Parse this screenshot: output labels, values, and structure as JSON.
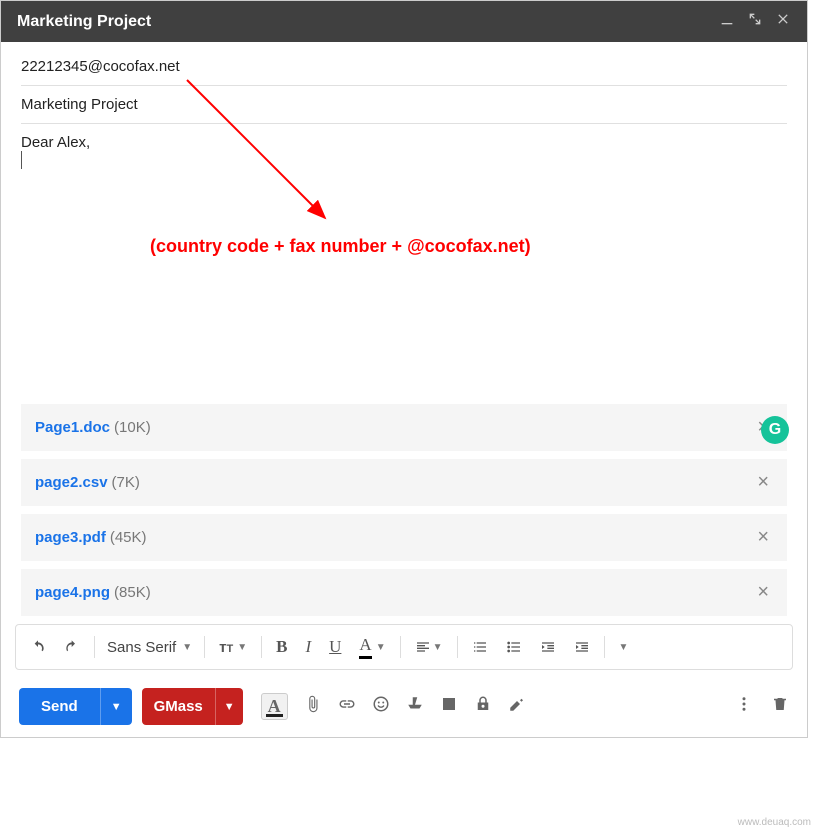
{
  "header": {
    "title": "Marketing Project"
  },
  "fields": {
    "to": "22212345@cocofax.net",
    "subject": "Marketing Project"
  },
  "body": {
    "greeting": "Dear Alex,"
  },
  "annotation": {
    "text": "(country code + fax number + @cocofax.net)"
  },
  "grammar_badge": "G",
  "attachments": [
    {
      "name": "Page1.doc",
      "size": "(10K)"
    },
    {
      "name": "page2.csv",
      "size": "(7K)"
    },
    {
      "name": "page3.pdf",
      "size": "(45K)"
    },
    {
      "name": "page4.png",
      "size": "(85K)"
    }
  ],
  "format_toolbar": {
    "font": "Sans Serif"
  },
  "actions": {
    "send": "Send",
    "gmass": "GMass"
  },
  "watermark": "www.deuaq.com"
}
